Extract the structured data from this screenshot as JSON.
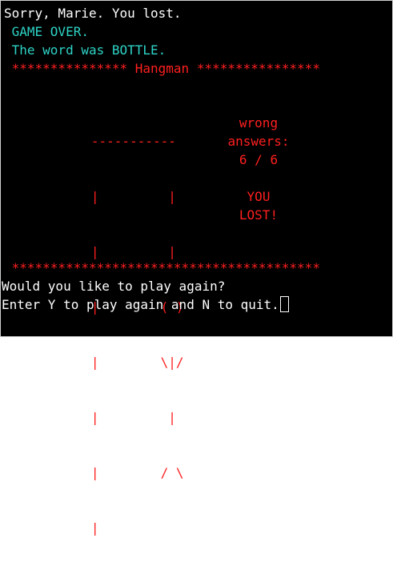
{
  "messages": {
    "sorry": "Sorry, Marie. You lost.",
    "game_over": " GAME OVER.",
    "word_reveal": " The word was BOTTLE."
  },
  "banner": {
    "top": " *************** Hangman ****************",
    "bottom": " ****************************************"
  },
  "gallows": [
    "   -----------",
    "   |         |",
    "   |         |",
    "   |        ( )",
    "   |        \\|/",
    "   |         |",
    "   |        / \\",
    "   |"
  ],
  "status": {
    "line1": "wrong",
    "line2": "answers:",
    "score": "6 / 6",
    "blank": "",
    "result1": "YOU",
    "result2": "LOST!"
  },
  "prompt": {
    "question": "Would you like to play again?",
    "instruction": "Enter Y to play again and N to quit."
  },
  "colors": {
    "background": "#000000",
    "text": "#ffffff",
    "accent": "#2ed3c6",
    "danger": "#ff1f1f"
  }
}
